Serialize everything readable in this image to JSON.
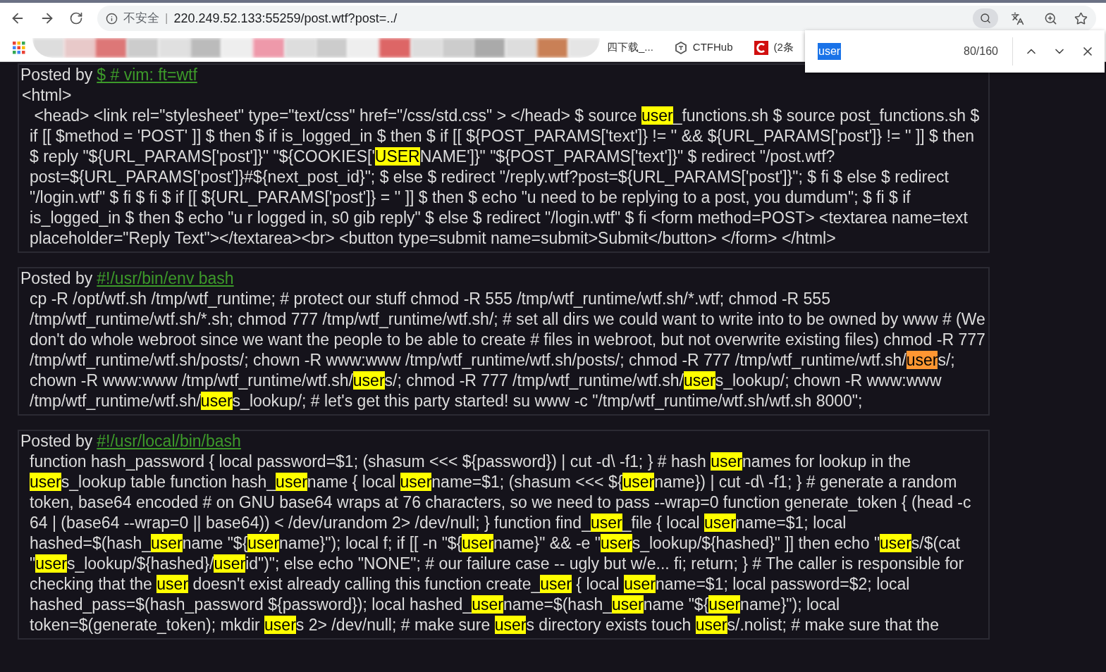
{
  "address_bar": {
    "security": "不安全",
    "separator": "|",
    "url": "220.249.52.133:55259/post.wtf?post=../"
  },
  "bookmarks": [
    {
      "label": "四下载_...",
      "kind": "plain"
    },
    {
      "label": "CTFHub",
      "kind": "ctfhub"
    },
    {
      "label": "(2条",
      "kind": "csdn"
    }
  ],
  "find_bar": {
    "query": "user",
    "count": "80/160"
  },
  "posts": [
    {
      "prefix": "Posted by",
      "author": "$ # vim: ft=wtf",
      "pre_line": "<html>",
      "segments": [
        {
          "text": " <head> <link rel=\"stylesheet\" type=\"text/css\" href=\"/css/std.css\" > </head> $ source ",
          "kind": "plain"
        },
        {
          "text": "user",
          "kind": "match"
        },
        {
          "text": "_functions.sh $ source post_functions.sh $ if [[ $method = 'POST' ]] $ then $ if is_logged_in $ then $ if [[ ${POST_PARAMS['text']} != '' && ${URL_PARAMS['post']} != '' ]] $ then $ reply \"${URL_PARAMS['post']}\" \"${COOKIES['",
          "kind": "plain"
        },
        {
          "text": "USER",
          "kind": "match"
        },
        {
          "text": "NAME']}\" \"${POST_PARAMS['text']}\" $ redirect \"/post.wtf?post=${URL_PARAMS['post']}#${next_post_id}\"; $ else $ redirect \"/reply.wtf?post=${URL_PARAMS['post']}\"; $ fi $ else $ redirect \"/login.wtf\" $ fi $ fi $ if [[ ${URL_PARAMS['post']} = '' ]] $ then $ echo \"u need to be replying to a post, you dumdum\"; $ fi $ if is_logged_in $ then $ echo \"u r logged in, s0 gib reply\" $ else $ redirect \"/login.wtf\" $ fi <form method=POST> <textarea name=text placeholder=\"Reply Text\"></textarea><br> <button type=submit name=submit>Submit</button> </form> </html>",
          "kind": "plain"
        }
      ]
    },
    {
      "prefix": "Posted by",
      "author": "#!/usr/bin/env bash",
      "segments": [
        {
          "text": "cp -R /opt/wtf.sh /tmp/wtf_runtime; # protect our stuff chmod -R 555 /tmp/wtf_runtime/wtf.sh/*.wtf; chmod -R 555 /tmp/wtf_runtime/wtf.sh/*.sh; chmod 777 /tmp/wtf_runtime/wtf.sh/; # set all dirs we could want to write into to be owned by www # (We don't do whole webroot since we want the people to be able to create # files in webroot, but not overwrite existing files) chmod -R 777 /tmp/wtf_runtime/wtf.sh/posts/; chown -R www:www /tmp/wtf_runtime/wtf.sh/posts/; chmod -R 777 /tmp/wtf_runtime/wtf.sh/",
          "kind": "plain"
        },
        {
          "text": "user",
          "kind": "current"
        },
        {
          "text": "s/; chown -R www:www /tmp/wtf_runtime/wtf.sh/",
          "kind": "plain"
        },
        {
          "text": "user",
          "kind": "match"
        },
        {
          "text": "s/; chmod -R 777 /tmp/wtf_runtime/wtf.sh/",
          "kind": "plain"
        },
        {
          "text": "user",
          "kind": "match"
        },
        {
          "text": "s_lookup/; chown -R www:www /tmp/wtf_runtime/wtf.sh/",
          "kind": "plain"
        },
        {
          "text": "user",
          "kind": "match"
        },
        {
          "text": "s_lookup/; # let's get this party started! su www -c \"/tmp/wtf_runtime/wtf.sh/wtf.sh 8000\";",
          "kind": "plain"
        }
      ]
    },
    {
      "prefix": "Posted by",
      "author": "#!/usr/local/bin/bash",
      "segments": [
        {
          "text": "function hash_password { local password=$1; (shasum <<< ${password}) | cut -d\\ -f1; } # hash ",
          "kind": "plain"
        },
        {
          "text": "user",
          "kind": "match"
        },
        {
          "text": "names for lookup in the ",
          "kind": "plain"
        },
        {
          "text": "user",
          "kind": "match"
        },
        {
          "text": "s_lookup table function hash_",
          "kind": "plain"
        },
        {
          "text": "user",
          "kind": "match"
        },
        {
          "text": "name { local ",
          "kind": "plain"
        },
        {
          "text": "user",
          "kind": "match"
        },
        {
          "text": "name=$1; (shasum <<< ${",
          "kind": "plain"
        },
        {
          "text": "user",
          "kind": "match"
        },
        {
          "text": "name}) | cut -d\\ -f1; } # generate a random token, base64 encoded # on GNU base64 wraps at 76 characters, so we need to pass --wrap=0 function generate_token { (head -c 64 | (base64 --wrap=0 || base64)) < /dev/urandom 2> /dev/null; } function find_",
          "kind": "plain"
        },
        {
          "text": "user",
          "kind": "match"
        },
        {
          "text": "_file { local ",
          "kind": "plain"
        },
        {
          "text": "user",
          "kind": "match"
        },
        {
          "text": "name=$1; local hashed=$(hash_",
          "kind": "plain"
        },
        {
          "text": "user",
          "kind": "match"
        },
        {
          "text": "name \"${",
          "kind": "plain"
        },
        {
          "text": "user",
          "kind": "match"
        },
        {
          "text": "name}\"); local f; if [[ -n \"${",
          "kind": "plain"
        },
        {
          "text": "user",
          "kind": "match"
        },
        {
          "text": "name}\" && -e \"",
          "kind": "plain"
        },
        {
          "text": "user",
          "kind": "match"
        },
        {
          "text": "s_lookup/${hashed}\" ]] then echo \"",
          "kind": "plain"
        },
        {
          "text": "user",
          "kind": "match"
        },
        {
          "text": "s/$(cat \"",
          "kind": "plain"
        },
        {
          "text": "user",
          "kind": "match"
        },
        {
          "text": "s_lookup/${hashed}/",
          "kind": "plain"
        },
        {
          "text": "user",
          "kind": "match"
        },
        {
          "text": "id\")\"; else echo \"NONE\"; # our failure case -- ugly but w/e... fi; return; } # The caller is responsible for checking that the ",
          "kind": "plain"
        },
        {
          "text": "user",
          "kind": "match"
        },
        {
          "text": " doesn't exist already calling this function create_",
          "kind": "plain"
        },
        {
          "text": "user",
          "kind": "match"
        },
        {
          "text": " { local ",
          "kind": "plain"
        },
        {
          "text": "user",
          "kind": "match"
        },
        {
          "text": "name=$1; local password=$2; local hashed_pass=$(hash_password ${password}); local hashed_",
          "kind": "plain"
        },
        {
          "text": "user",
          "kind": "match"
        },
        {
          "text": "name=$(hash_",
          "kind": "plain"
        },
        {
          "text": "user",
          "kind": "match"
        },
        {
          "text": "name \"${",
          "kind": "plain"
        },
        {
          "text": "user",
          "kind": "match"
        },
        {
          "text": "name}\"); local token=$(generate_token); mkdir ",
          "kind": "plain"
        },
        {
          "text": "user",
          "kind": "match"
        },
        {
          "text": "s 2> /dev/null; # make sure ",
          "kind": "plain"
        },
        {
          "text": "user",
          "kind": "match"
        },
        {
          "text": "s directory exists touch ",
          "kind": "plain"
        },
        {
          "text": "user",
          "kind": "match"
        },
        {
          "text": "s/.nolist; # make sure that the",
          "kind": "plain"
        }
      ]
    }
  ]
}
